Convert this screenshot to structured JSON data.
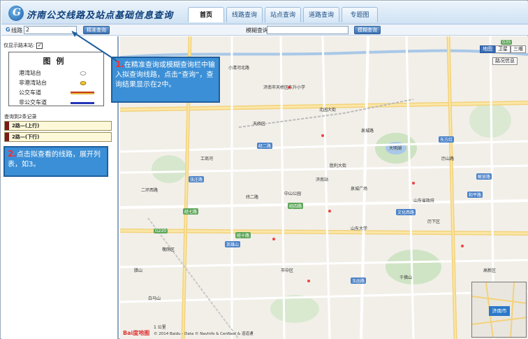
{
  "app_title": "济南公交线路及站点基础信息查询",
  "nav": {
    "tabs": [
      "首页",
      "线路查询",
      "站点查询",
      "道路查询",
      "专题图"
    ]
  },
  "search": {
    "line_label": "线路",
    "line_value": "2",
    "exact_btn": "精准查询",
    "fuzzy_label": "模糊查询",
    "fuzzy_value": "",
    "fuzzy_btn": "模糊查询"
  },
  "sidebar": {
    "show_stops_label": "仅显示路末站:",
    "checkbox_mark": "✓",
    "legend": {
      "title": "图例",
      "items": [
        "港湾站台",
        "非港湾站台",
        "公交车道",
        "非公交车道"
      ]
    },
    "results_label": "查询到2条记录",
    "results": [
      "2路—(上行)",
      "2路—(下行)"
    ]
  },
  "map": {
    "types": [
      "地图",
      "卫星",
      "三维"
    ],
    "traffic_btn": "路况信息",
    "overview_city": "济南市",
    "scale": "1 公里",
    "footer_logo": "Bai度地图",
    "footer_text": "© 2014 Baidu - Data © NavInfo & CenNavi & 道道通",
    "labels": {
      "dongsheng": "济南市天桥区东升小学",
      "beiyuan": "北园大街",
      "tianqiao": "天桥区",
      "xiaoqinghe": "小清河北路",
      "jinan_rail": "济南站",
      "jiefang": "解放路",
      "quancheng": "泉城广场",
      "jingqi": "经七路",
      "jingshi": "经十路",
      "erhuan": "二环西路",
      "huaiyin": "槐荫区",
      "lixia": "历下区",
      "shizhong": "市中区",
      "shanda": "山东大学",
      "qianfoshan": "千佛山",
      "daming": "大明湖",
      "wenhua": "文化西路",
      "heping": "和平路",
      "gongshang": "工商河",
      "zhuangzhuang": "张庄路",
      "weier": "纬二路",
      "lishan": "历山路",
      "shandong_province": "山东省政府",
      "yushan": "玉函路",
      "shengli": "胜利大街",
      "gaoxin": "高新区",
      "bailiang": "白马山",
      "lashan": "腊山",
      "dongfang": "东方红",
      "quan": "泉城路",
      "gongyuan": "中山公园",
      "yingxiong": "英雄山",
      "road1": "经四路",
      "road2": "经二路",
      "g220": "G220",
      "g35": "G35"
    }
  },
  "callouts": {
    "one_num": "1.",
    "one_text": "在精准查询或模糊查询栏中输入拟查询线路，点击“查询”，查询结果显示在2中。",
    "two_num": "2.",
    "two_text": "点击拟查看的线路，展开列表，如3。"
  },
  "colors": {
    "bus_lane": "#c33a1a",
    "non_bus_lane": "#2336b8",
    "callout": "#3b8fd6"
  }
}
